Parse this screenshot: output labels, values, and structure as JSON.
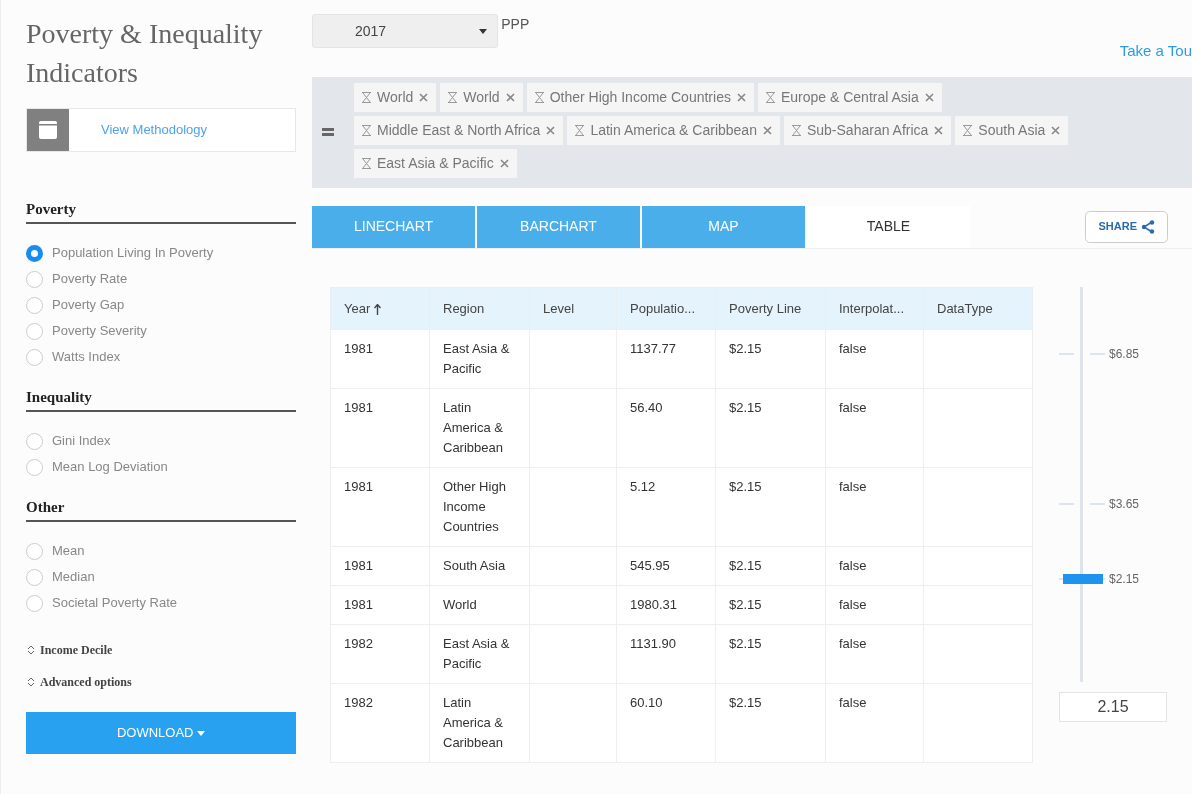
{
  "sidebar": {
    "title": "Poverty & Inequality Indicators",
    "methodology_link": "View Methodology",
    "sections": [
      {
        "heading": "Poverty",
        "options": [
          {
            "label": "Population Living In Poverty",
            "selected": true
          },
          {
            "label": "Poverty Rate",
            "selected": false
          },
          {
            "label": "Poverty Gap",
            "selected": false
          },
          {
            "label": "Poverty Severity",
            "selected": false
          },
          {
            "label": "Watts Index",
            "selected": false
          }
        ]
      },
      {
        "heading": "Inequality",
        "options": [
          {
            "label": "Gini Index",
            "selected": false
          },
          {
            "label": "Mean Log Deviation",
            "selected": false
          }
        ]
      },
      {
        "heading": "Other",
        "options": [
          {
            "label": "Mean",
            "selected": false
          },
          {
            "label": "Median",
            "selected": false
          },
          {
            "label": "Societal Poverty Rate",
            "selected": false
          }
        ]
      }
    ],
    "expanders": [
      {
        "label": "Income Decile",
        "expanded": false
      },
      {
        "label": "Advanced options",
        "expanded": false
      }
    ],
    "download_button": "DOWNLOAD"
  },
  "ppp_select": {
    "value": "2017",
    "label": "PPP"
  },
  "tour_link": "Take a Tou",
  "region_chips": [
    "World",
    "World",
    "Other High Income Countries",
    "Europe & Central Asia",
    "Middle East & North Africa",
    "Latin America & Caribbean",
    "Sub-Saharan Africa",
    "South Asia",
    "East Asia & Pacific"
  ],
  "tabs": [
    {
      "label": "LINECHART",
      "selected": false
    },
    {
      "label": "BARCHART",
      "selected": false
    },
    {
      "label": "MAP",
      "selected": false
    },
    {
      "label": "TABLE",
      "selected": true
    }
  ],
  "share_button": "SHARE",
  "table": {
    "columns": [
      {
        "label": "Year",
        "sorted": true
      },
      {
        "label": "Region",
        "sorted": false
      },
      {
        "label": "Level",
        "sorted": false
      },
      {
        "label": "Populatio...",
        "sorted": false
      },
      {
        "label": "Poverty Line",
        "sorted": false
      },
      {
        "label": "Interpolat...",
        "sorted": false
      },
      {
        "label": "DataType",
        "sorted": false
      }
    ],
    "rows": [
      [
        "1981",
        "East Asia & Pacific",
        "",
        "1137.77",
        "$2.15",
        "false",
        ""
      ],
      [
        "1981",
        "Latin America & Caribbean",
        "",
        "56.40",
        "$2.15",
        "false",
        ""
      ],
      [
        "1981",
        "Other High Income Countries",
        "",
        "5.12",
        "$2.15",
        "false",
        ""
      ],
      [
        "1981",
        "South Asia",
        "",
        "545.95",
        "$2.15",
        "false",
        ""
      ],
      [
        "1981",
        "World",
        "",
        "1980.31",
        "$2.15",
        "false",
        ""
      ],
      [
        "1982",
        "East Asia & Pacific",
        "",
        "1131.90",
        "$2.15",
        "false",
        ""
      ],
      [
        "1982",
        "Latin America & Caribbean",
        "",
        "60.10",
        "$2.15",
        "false",
        ""
      ]
    ]
  },
  "poverty_line_slider": {
    "ticks": [
      {
        "label": "$6.85"
      },
      {
        "label": "$3.65"
      },
      {
        "label": "$2.15"
      }
    ],
    "level": 0.26,
    "value": "2.15"
  }
}
